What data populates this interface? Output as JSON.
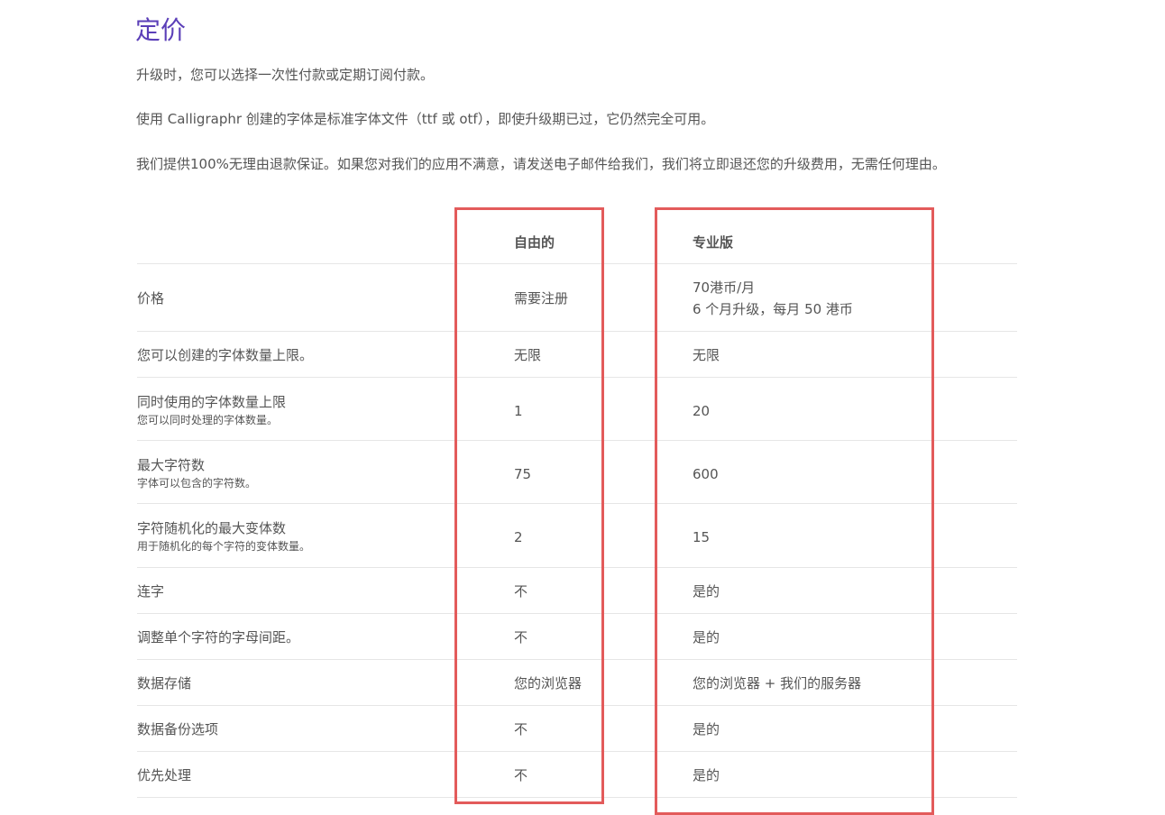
{
  "page": {
    "title": "定价",
    "paragraphs": [
      "升级时，您可以选择一次性付款或定期订阅付款。",
      "使用 Calligraphr 创建的字体是标准字体文件（ttf 或 otf），即使升级期已过，它仍然完全可用。",
      "我们提供100%无理由退款保证。如果您对我们的应用不满意，请发送电子邮件给我们，我们将立即退还您的升级费用，无需任何理由。"
    ]
  },
  "table": {
    "columns": {
      "feature": "",
      "free": "自由的",
      "pro": "专业版"
    },
    "rows": [
      {
        "feature": "价格",
        "sub": "",
        "free": "需要注册",
        "pro": "70港币/月",
        "pro_line2": "6 个月升级，每月 50 港币"
      },
      {
        "feature": "您可以创建的字体数量上限。",
        "sub": "",
        "free": "无限",
        "pro": "无限",
        "pro_line2": ""
      },
      {
        "feature": "同时使用的字体数量上限",
        "sub": "您可以同时处理的字体数量。",
        "free": "1",
        "pro": "20",
        "pro_line2": ""
      },
      {
        "feature": "最大字符数",
        "sub": "字体可以包含的字符数。",
        "free": "75",
        "pro": "600",
        "pro_line2": ""
      },
      {
        "feature": "字符随机化的最大变体数",
        "sub": "用于随机化的每个字符的变体数量。",
        "free": "2",
        "pro": "15",
        "pro_line2": ""
      },
      {
        "feature": "连字",
        "sub": "",
        "free": "不",
        "pro": "是的",
        "pro_line2": ""
      },
      {
        "feature": "调整单个字符的字母间距。",
        "sub": "",
        "free": "不",
        "pro": "是的",
        "pro_line2": ""
      },
      {
        "feature": "数据存储",
        "sub": "",
        "free": "您的浏览器",
        "pro": "您的浏览器 + 我们的服务器",
        "pro_line2": ""
      },
      {
        "feature": "数据备份选项",
        "sub": "",
        "free": "不",
        "pro": "是的",
        "pro_line2": ""
      },
      {
        "feature": "优先处理",
        "sub": "",
        "free": "不",
        "pro": "是的",
        "pro_line2": ""
      }
    ]
  },
  "colors": {
    "title": "#5b3fb8",
    "text": "#555555",
    "divider": "#e6e6e6",
    "highlight": "#e35b5b"
  }
}
